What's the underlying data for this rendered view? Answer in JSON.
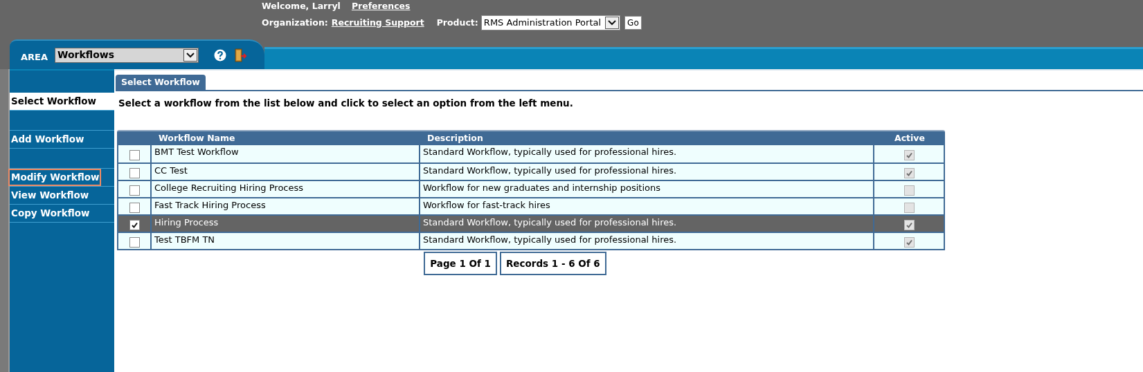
{
  "header": {
    "welcome": "Welcome, Larryl",
    "preferences_link": "Preferences",
    "organization_label": "Organization:",
    "organization_link": "Recruiting Support",
    "product_label": "Product:",
    "product_select": "RMS Administration Portal",
    "go_button": "Go"
  },
  "area": {
    "label": "AREA",
    "select": "Workflows"
  },
  "sidebar": {
    "items": [
      {
        "label": "Select Workflow",
        "selected": true,
        "outlined": false,
        "gap_before": false
      },
      {
        "label": "Add Workflow",
        "selected": false,
        "outlined": false,
        "gap_before": true
      },
      {
        "label": "Modify Workflow",
        "selected": false,
        "outlined": true,
        "gap_before": true
      },
      {
        "label": "View Workflow",
        "selected": false,
        "outlined": false,
        "gap_before": false
      },
      {
        "label": "Copy Workflow",
        "selected": false,
        "outlined": false,
        "gap_before": false
      }
    ]
  },
  "tabs": [
    {
      "label": "Select Workflow",
      "selected": true
    }
  ],
  "instructions": "Select a workflow from the list below and click to select an option from the left menu.",
  "table": {
    "columns": [
      "Workflow Name",
      "Description",
      "Active"
    ],
    "rows": [
      {
        "selected": false,
        "name": "BMT Test Workflow",
        "description": "Standard Workflow, typically used for professional hires.",
        "active": true
      },
      {
        "selected": false,
        "name": "CC Test",
        "description": "Standard Workflow, typically used for professional hires.",
        "active": true
      },
      {
        "selected": false,
        "name": "College Recruiting Hiring Process",
        "description": "Workflow for new graduates and internship positions",
        "active": false
      },
      {
        "selected": false,
        "name": "Fast Track Hiring Process",
        "description": "Workflow for fast-track hires",
        "active": false
      },
      {
        "selected": true,
        "name": "Hiring Process",
        "description": "Standard Workflow, typically used for professional hires.",
        "active": true
      },
      {
        "selected": false,
        "name": "Test TBFM TN",
        "description": "Standard Workflow, typically used for professional hires.",
        "active": true
      }
    ]
  },
  "pagination": [
    "Page 1 Of 1",
    "Records 1 - 6 Of 6"
  ]
}
